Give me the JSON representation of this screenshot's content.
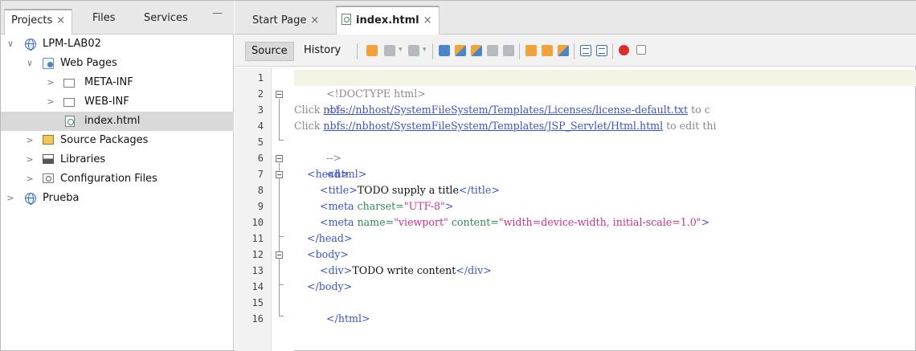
{
  "left_panel": {
    "tabs": [
      {
        "label": "Projects",
        "close": "×"
      },
      {
        "label": "Files"
      },
      {
        "label": "Services"
      }
    ],
    "minimize": "—",
    "tree": [
      {
        "label": "LPM-LAB02",
        "icon": "globe-icon",
        "twist": "∨"
      },
      {
        "label": "Web Pages",
        "icon": "web-folder-icon",
        "twist": "∨"
      },
      {
        "label": "META-INF",
        "icon": "folder-icon",
        "twist": ">"
      },
      {
        "label": "WEB-INF",
        "icon": "folder-icon",
        "twist": ">"
      },
      {
        "label": "index.html",
        "icon": "html-file-icon",
        "twist": "",
        "selected": true
      },
      {
        "label": "Source Packages",
        "icon": "package-icon",
        "twist": ">"
      },
      {
        "label": "Libraries",
        "icon": "library-icon",
        "twist": ">"
      },
      {
        "label": "Configuration Files",
        "icon": "config-icon",
        "twist": ">"
      },
      {
        "label": "Prueba",
        "icon": "globe-icon",
        "twist": ">"
      }
    ]
  },
  "editor_tabs": [
    {
      "label": "Start Page",
      "close": "×"
    },
    {
      "label": "index.html",
      "close": "×",
      "active": true
    }
  ],
  "toolbar": {
    "source_label": "Source",
    "history_label": "History"
  },
  "editor": {
    "lines": [
      "1",
      "2",
      "3",
      "4",
      "5",
      "6",
      "7",
      "8",
      "9",
      "10",
      "11",
      "12",
      "13",
      "14",
      "15",
      "16"
    ],
    "code": {
      "l1": "<!DOCTYPE html>",
      "l2": "<!--",
      "l3_pre": "Click ",
      "l3_link": "nbfs://nbhost/SystemFileSystem/Templates/Licenses/license-default.txt",
      "l3_post": " to c",
      "l4_pre": "Click ",
      "l4_link": "nbfs://nbhost/SystemFileSystem/Templates/JSP_Servlet/Html.html",
      "l4_post": " to edit thi",
      "l5": "-->",
      "l6": "<html>",
      "l7": "<head>",
      "l8_open": "<title>",
      "l8_text": "TODO supply a title",
      "l8_close": "</title>",
      "l9_tag": "<meta ",
      "l9_attr": "charset=",
      "l9_val": "\"UTF-8\"",
      "l9_end": ">",
      "l10_tag": "<meta ",
      "l10_attr1": "name=",
      "l10_val1": "\"viewport\"",
      "l10_attr2": " content=",
      "l10_val2": "\"width=device-width, initial-scale=1.0\"",
      "l10_end": ">",
      "l11": "</head>",
      "l12": "<body>",
      "l13_open": "<div>",
      "l13_text": "TODO write content",
      "l13_close": "</div>",
      "l14": "</body>",
      "l15": "</html>"
    }
  }
}
